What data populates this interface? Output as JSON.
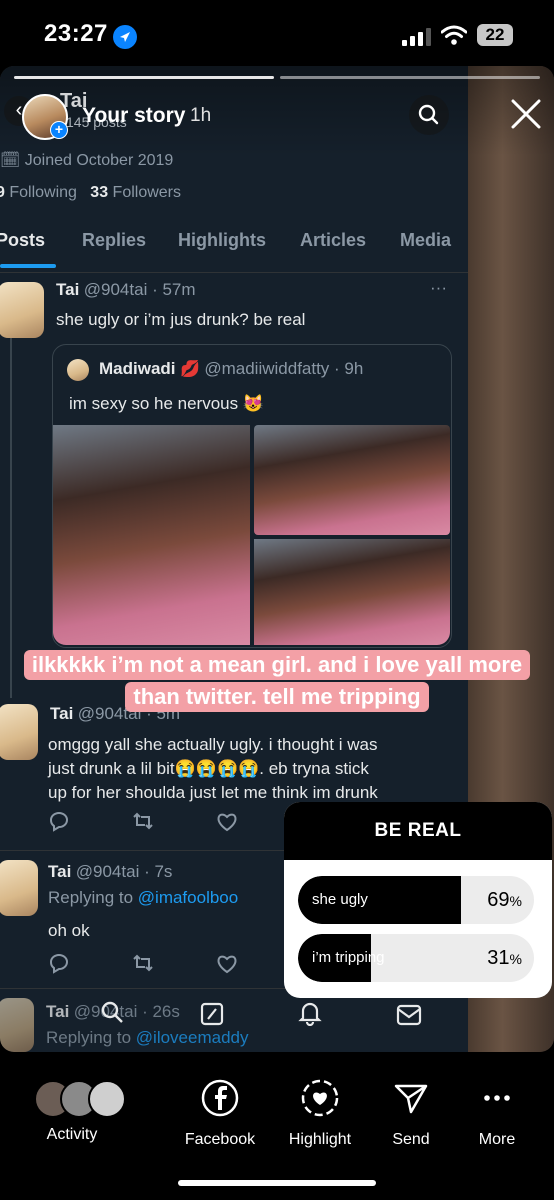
{
  "status_bar": {
    "time": "23:27",
    "battery": "22"
  },
  "story": {
    "title": "Your story",
    "time_ago": "1h",
    "caption_line1": "ilkkkkk i’m not a mean girl. and i love yall more",
    "caption_line2": "than twitter. tell me  tripping"
  },
  "profile": {
    "name": "Tai",
    "posts": "145 posts",
    "joined": "Joined October 2019",
    "following_count": "9",
    "following_label": "Following",
    "followers_count": "33",
    "followers_label": "Followers"
  },
  "tabs": [
    "Posts",
    "Replies",
    "Highlights",
    "Articles",
    "Media"
  ],
  "tweets": [
    {
      "name": "Tai",
      "handle_time": "@904tai · 57m",
      "text": "she ugly or i’m jus drunk? be real",
      "quote": {
        "name": "Madiwadi",
        "emoji": "💋",
        "handle_time": "@madiiwiddfatty · 9h",
        "text": "im sexy so he nervous 😻"
      }
    },
    {
      "name": "Tai",
      "handle_time": "@904tai · 5m",
      "text1": "omggg yall she actually ugly. i thought i was",
      "text2": "just drunk a lil bit😭😭😭😭. eb tryna stick",
      "text3": "up for her shoulda just let me think im drunk"
    },
    {
      "name": "Tai",
      "handle_time": "@904tai · 7s",
      "replying_prefix": "Replying to ",
      "replying_to": "@imafoolboo",
      "text": "oh ok"
    },
    {
      "name": "Tai",
      "handle_time": "@904tai · 26s",
      "replying_prefix": "Replying to ",
      "replying_to": "@iloveemaddy"
    }
  ],
  "poll": {
    "question": "BE REAL",
    "options": [
      {
        "label": "she ugly",
        "percent_text": "69",
        "percent": 69
      },
      {
        "label": "i’m tripping",
        "percent_text": "31",
        "percent": 31
      }
    ],
    "percent_sign": "%"
  },
  "bottom_bar": {
    "activity": "Activity",
    "facebook": "Facebook",
    "highlight": "Highlight",
    "send": "Send",
    "more": "More"
  },
  "colors": {
    "twitter_bg": "#15202b",
    "accent": "#1d9bf0",
    "caption_bg": "#f3a0a6"
  },
  "icons": [
    "location-arrow-icon",
    "signal-icon",
    "wifi-icon",
    "search-icon",
    "close-icon",
    "reply-icon",
    "retweet-icon",
    "like-icon",
    "facebook-icon",
    "heart-circle-icon",
    "send-icon",
    "more-icon"
  ]
}
